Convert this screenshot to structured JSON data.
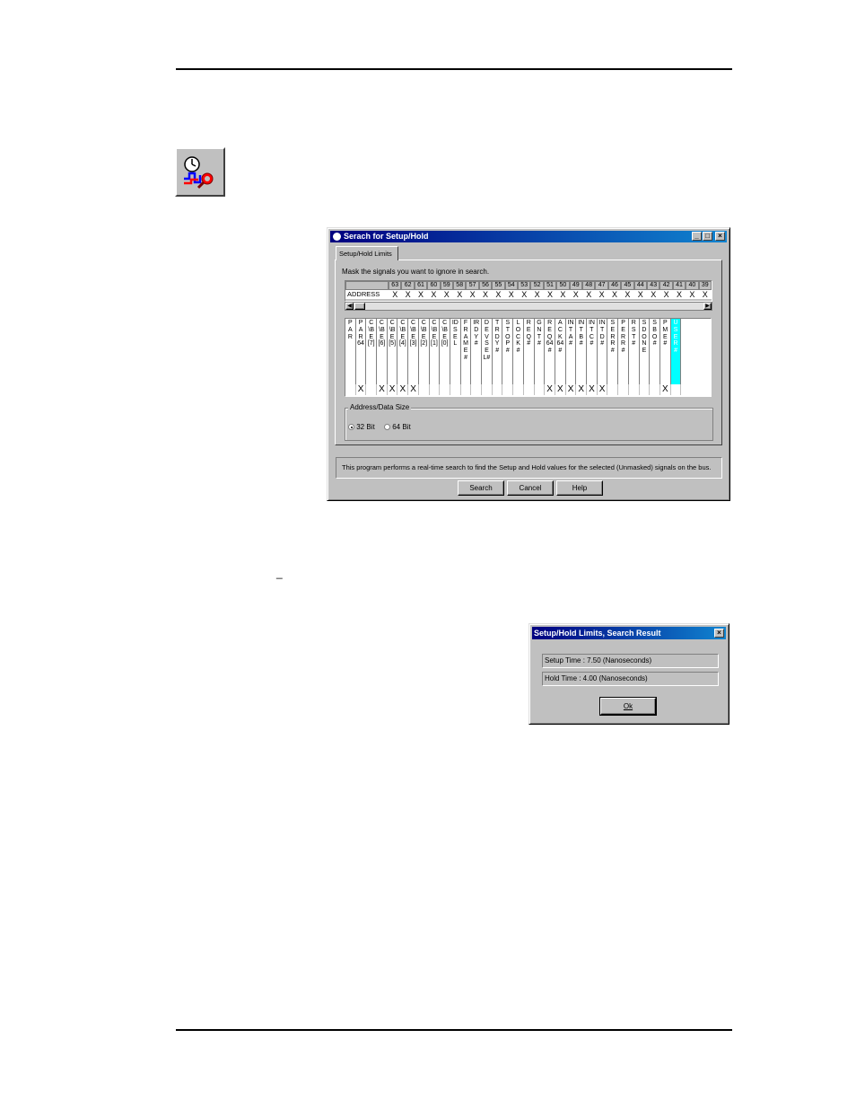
{
  "main_dialog": {
    "title": "Serach for Setup/Hold",
    "tab": "Setup/Hold Limits",
    "instruction": "Mask the signals you want to ignore in search.",
    "address_label": "ADDRESS",
    "address_bits": [
      "63",
      "62",
      "61",
      "60",
      "59",
      "58",
      "57",
      "56",
      "55",
      "54",
      "53",
      "52",
      "51",
      "50",
      "49",
      "48",
      "47",
      "46",
      "45",
      "44",
      "43",
      "42",
      "41",
      "40",
      "39"
    ],
    "address_marks": [
      "X",
      "X",
      "X",
      "X",
      "X",
      "X",
      "X",
      "X",
      "X",
      "X",
      "X",
      "X",
      "X",
      "X",
      "X",
      "X",
      "X",
      "X",
      "X",
      "X",
      "X",
      "X",
      "X",
      "X",
      "X"
    ],
    "signals": [
      {
        "label": "PAR",
        "mask": ""
      },
      {
        "label": "PAR64",
        "mask": "X"
      },
      {
        "label": "C\\BE[7]",
        "mask": ""
      },
      {
        "label": "C\\BE[6]",
        "mask": "X"
      },
      {
        "label": "C\\BE[5]",
        "mask": "X"
      },
      {
        "label": "C\\BE[4]",
        "mask": "X"
      },
      {
        "label": "C\\BE[3]",
        "mask": "X"
      },
      {
        "label": "C\\BE[2]",
        "mask": ""
      },
      {
        "label": "C\\BE[1]",
        "mask": ""
      },
      {
        "label": "C\\BE[0]",
        "mask": ""
      },
      {
        "label": "IDSEL",
        "mask": ""
      },
      {
        "label": "FRAME#",
        "mask": ""
      },
      {
        "label": "IRDY#",
        "mask": ""
      },
      {
        "label": "DEVSEL#",
        "mask": ""
      },
      {
        "label": "TRDY#",
        "mask": ""
      },
      {
        "label": "STOP#",
        "mask": ""
      },
      {
        "label": "LOCK#",
        "mask": ""
      },
      {
        "label": "REQ#",
        "mask": ""
      },
      {
        "label": "GNT#",
        "mask": ""
      },
      {
        "label": "REQ64#",
        "mask": "X"
      },
      {
        "label": "ACK64#",
        "mask": "X"
      },
      {
        "label": "INTA#",
        "mask": "X"
      },
      {
        "label": "INTB#",
        "mask": "X"
      },
      {
        "label": "INTC#",
        "mask": "X"
      },
      {
        "label": "INTD#",
        "mask": "X"
      },
      {
        "label": "SERR#",
        "mask": ""
      },
      {
        "label": "PERR#",
        "mask": ""
      },
      {
        "label": "RST#",
        "mask": ""
      },
      {
        "label": "SDONE",
        "mask": ""
      },
      {
        "label": "SBO#",
        "mask": ""
      },
      {
        "label": "PME#",
        "mask": "X"
      },
      {
        "label": "USER#",
        "mask": "",
        "highlight": true
      }
    ],
    "size_group_label": "Address/Data Size",
    "size_options": {
      "opt32": "32 Bit",
      "opt64": "64 Bit",
      "selected": "32 Bit"
    },
    "info_text": "This program performs a real-time search to find the Setup and Hold values for the selected (Unmasked) signals on the bus.",
    "buttons": {
      "search": "Search",
      "cancel": "Cancel",
      "help": "Help"
    },
    "window_controls": {
      "minimize": "_",
      "maximize": "□",
      "close": "×"
    }
  },
  "result_dialog": {
    "title": "Setup/Hold Limits, Search Result",
    "setup_line": "Setup Time :  7.50   (Nanoseconds)",
    "hold_line": "Hold   Time :  4.00   (Nanoseconds)",
    "ok": "Ok",
    "close": "×"
  },
  "page": {
    "stray_mark": "_"
  },
  "colors": {
    "title_bar": "#000080",
    "window_face": "#c0c0c0",
    "highlight_column": "#00ffff"
  },
  "icons": [
    "search-setup-hold-tool-icon"
  ]
}
